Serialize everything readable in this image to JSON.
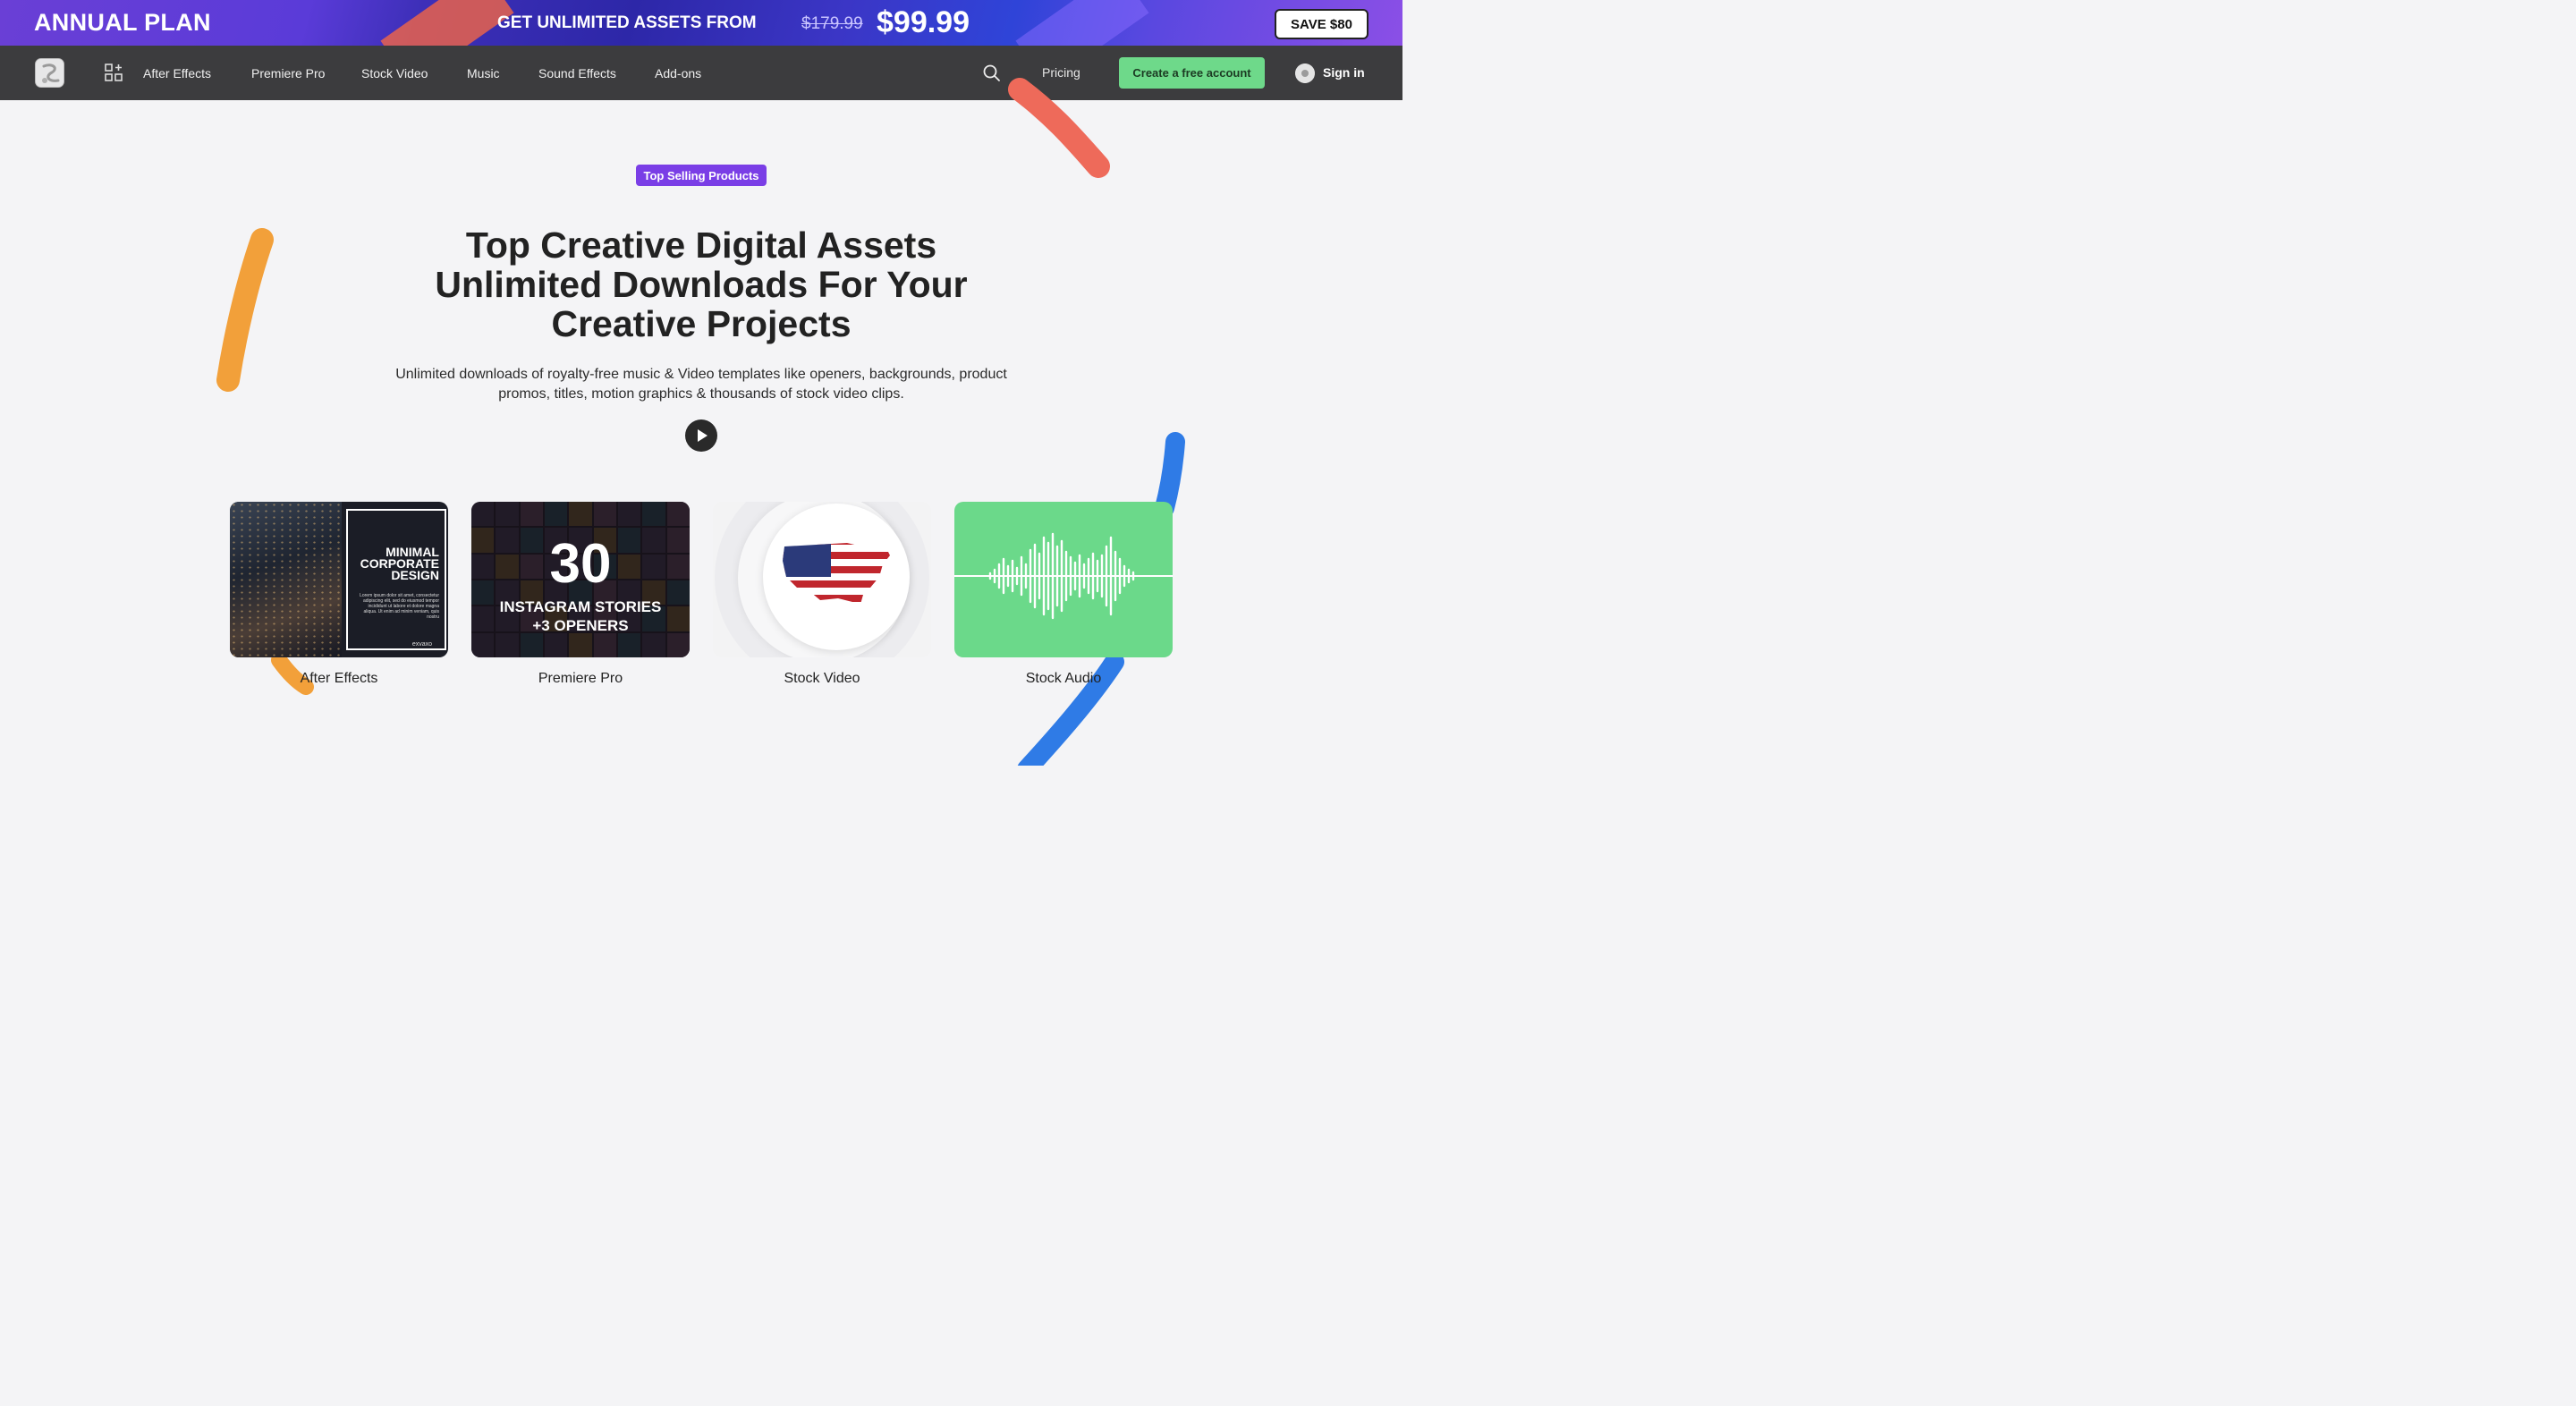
{
  "promo": {
    "left_title": "ANNUAL PLAN",
    "center_text": "GET UNLIMITED ASSETS FROM",
    "old_price": "$179.99",
    "new_price": "$99.99",
    "save_button": "SAVE $80"
  },
  "nav": {
    "items": [
      {
        "label": "After Effects"
      },
      {
        "label": "Premiere Pro"
      },
      {
        "label": "Stock Video"
      },
      {
        "label": "Music"
      },
      {
        "label": "Sound Effects"
      },
      {
        "label": "Add-ons"
      }
    ],
    "pricing": "Pricing",
    "cta": "Create a free account",
    "signin": "Sign in"
  },
  "hero": {
    "badge": "Top Selling Products",
    "title_lines": [
      "Top Creative Digital Assets",
      "Unlimited Downloads For Your",
      "Creative Projects"
    ],
    "subtitle": "Unlimited downloads of royalty-free music & Video templates like openers, backgrounds, product promos, titles, motion graphics & thousands of stock video clips."
  },
  "cards": [
    {
      "label": "After Effects",
      "thumb_title_lines": [
        "MINIMAL",
        "CORPORATE",
        "DESIGN"
      ],
      "thumb_body": "Lorem ipsum dolor sit amet, consectetur adipiscing elit, sed do eiusmod tempor incididunt ut labore et dolore magna aliqua. Ut enim ad minim veniam, quis nostru",
      "thumb_brand": "exvaxo"
    },
    {
      "label": "Premiere Pro",
      "thumb_number": "30",
      "thumb_line1": "INSTAGRAM STORIES",
      "thumb_line2": "+3 OPENERS"
    },
    {
      "label": "Stock Video"
    },
    {
      "label": "Stock Audio"
    }
  ],
  "colors": {
    "accent_purple": "#7a3ee6",
    "cta_green": "#6ed98a",
    "nav_bg": "#3c3c3e",
    "audio_green": "#6bd98a",
    "deco_orange": "#f2a03a",
    "deco_red": "#ee6a5a",
    "deco_blue": "#2f7be6"
  },
  "icons": [
    "logo-icon",
    "grid-icon",
    "search-icon",
    "avatar-icon",
    "play-icon",
    "usa-map-icon",
    "waveform-icon"
  ]
}
